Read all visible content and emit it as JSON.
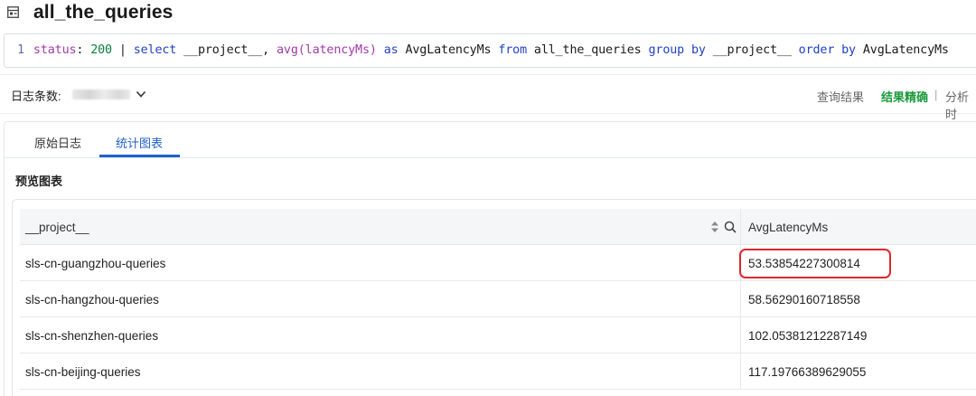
{
  "header": {
    "title": "all_the_queries"
  },
  "query": {
    "line_number": "1",
    "tokens": [
      {
        "t": "status",
        "c": "fld"
      },
      {
        "t": ": ",
        "c": "plain"
      },
      {
        "t": "200",
        "c": "num"
      },
      {
        "t": " | ",
        "c": "plain"
      },
      {
        "t": "select",
        "c": "kw"
      },
      {
        "t": " __project__, ",
        "c": "plain"
      },
      {
        "t": "avg",
        "c": "fn"
      },
      {
        "t": "(",
        "c": "fn"
      },
      {
        "t": "latencyMs",
        "c": "fld"
      },
      {
        "t": ")",
        "c": "fn"
      },
      {
        "t": " ",
        "c": "plain"
      },
      {
        "t": "as",
        "c": "kw"
      },
      {
        "t": " AvgLatencyMs ",
        "c": "plain"
      },
      {
        "t": "from",
        "c": "kw"
      },
      {
        "t": " all_the_queries ",
        "c": "plain"
      },
      {
        "t": "group by",
        "c": "kw"
      },
      {
        "t": " __project__ ",
        "c": "plain"
      },
      {
        "t": "order by",
        "c": "kw"
      },
      {
        "t": " AvgLatencyMs",
        "c": "plain"
      }
    ]
  },
  "toolbar": {
    "count_label": "日志条数:",
    "query_result": "查询结果",
    "result_precise": "结果精确",
    "separator": "|",
    "analysis_time": "分析时"
  },
  "tabs": [
    {
      "label": "原始日志",
      "active": false
    },
    {
      "label": "统计图表",
      "active": true
    }
  ],
  "preview": {
    "title": "预览图表"
  },
  "table": {
    "columns": [
      "__project__",
      "AvgLatencyMs"
    ],
    "rows": [
      [
        "sls-cn-guangzhou-queries",
        "53.53854227300814"
      ],
      [
        "sls-cn-hangzhou-queries",
        "58.56290160718558"
      ],
      [
        "sls-cn-shenzhen-queries",
        "102.05381212287149"
      ],
      [
        "sls-cn-beijing-queries",
        "117.19766389629055"
      ]
    ],
    "highlighted_row": 0
  },
  "colors": {
    "accent": "#1f62c9",
    "success": "#1a9a3a",
    "highlight": "#e0262c"
  }
}
